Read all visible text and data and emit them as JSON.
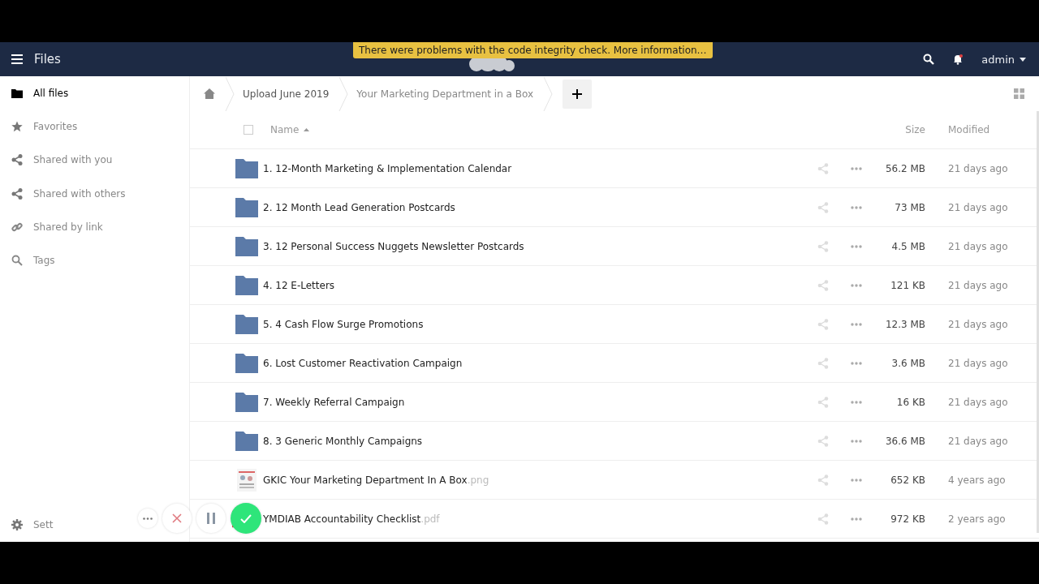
{
  "header": {
    "app_title": "Files",
    "banner": "There were problems with the code integrity check. More information…",
    "user": "admin"
  },
  "sidebar": {
    "items": [
      {
        "label": "All files",
        "kind": "folder",
        "selected": true
      },
      {
        "label": "Favorites",
        "kind": "star",
        "selected": false
      },
      {
        "label": "Shared with you",
        "kind": "share",
        "selected": false
      },
      {
        "label": "Shared with others",
        "kind": "share",
        "selected": false
      },
      {
        "label": "Shared by link",
        "kind": "link",
        "selected": false
      },
      {
        "label": "Tags",
        "kind": "tag",
        "selected": false
      }
    ],
    "settings": "Sett"
  },
  "breadcrumbs": [
    "Upload June 2019",
    "Your Marketing Department in a Box"
  ],
  "table": {
    "select_all_checked": false,
    "columns": [
      "Name",
      "Size",
      "Modified"
    ],
    "rows": [
      {
        "kind": "folder",
        "name": "1. 12-Month Marketing & Implementation Calendar",
        "size": "56.2 MB",
        "modified": "21 days ago"
      },
      {
        "kind": "folder",
        "name": "2. 12 Month Lead Generation Postcards",
        "size": "73 MB",
        "modified": "21 days ago"
      },
      {
        "kind": "folder",
        "name": "3. 12 Personal Success Nuggets Newsletter Postcards",
        "size": "4.5 MB",
        "modified": "21 days ago"
      },
      {
        "kind": "folder",
        "name": "4. 12 E-Letters",
        "size": "121 KB",
        "modified": "21 days ago"
      },
      {
        "kind": "folder",
        "name": "5. 4 Cash Flow Surge Promotions",
        "size": "12.3 MB",
        "modified": "21 days ago"
      },
      {
        "kind": "folder",
        "name": "6. Lost Customer Reactivation Campaign",
        "size": "3.6 MB",
        "modified": "21 days ago"
      },
      {
        "kind": "folder",
        "name": "7. Weekly Referral Campaign",
        "size": "16 KB",
        "modified": "21 days ago"
      },
      {
        "kind": "folder",
        "name": "8. 3 Generic Monthly Campaigns",
        "size": "36.6 MB",
        "modified": "21 days ago"
      },
      {
        "kind": "image",
        "name": "GKIC Your Marketing Department In A Box",
        "ext": ".png",
        "size": "652 KB",
        "modified": "4 years ago"
      },
      {
        "kind": "pdf",
        "name": "YMDIAB Accountability Checklist",
        "ext": ".pdf",
        "size": "972 KB",
        "modified": "2 years ago"
      }
    ]
  }
}
